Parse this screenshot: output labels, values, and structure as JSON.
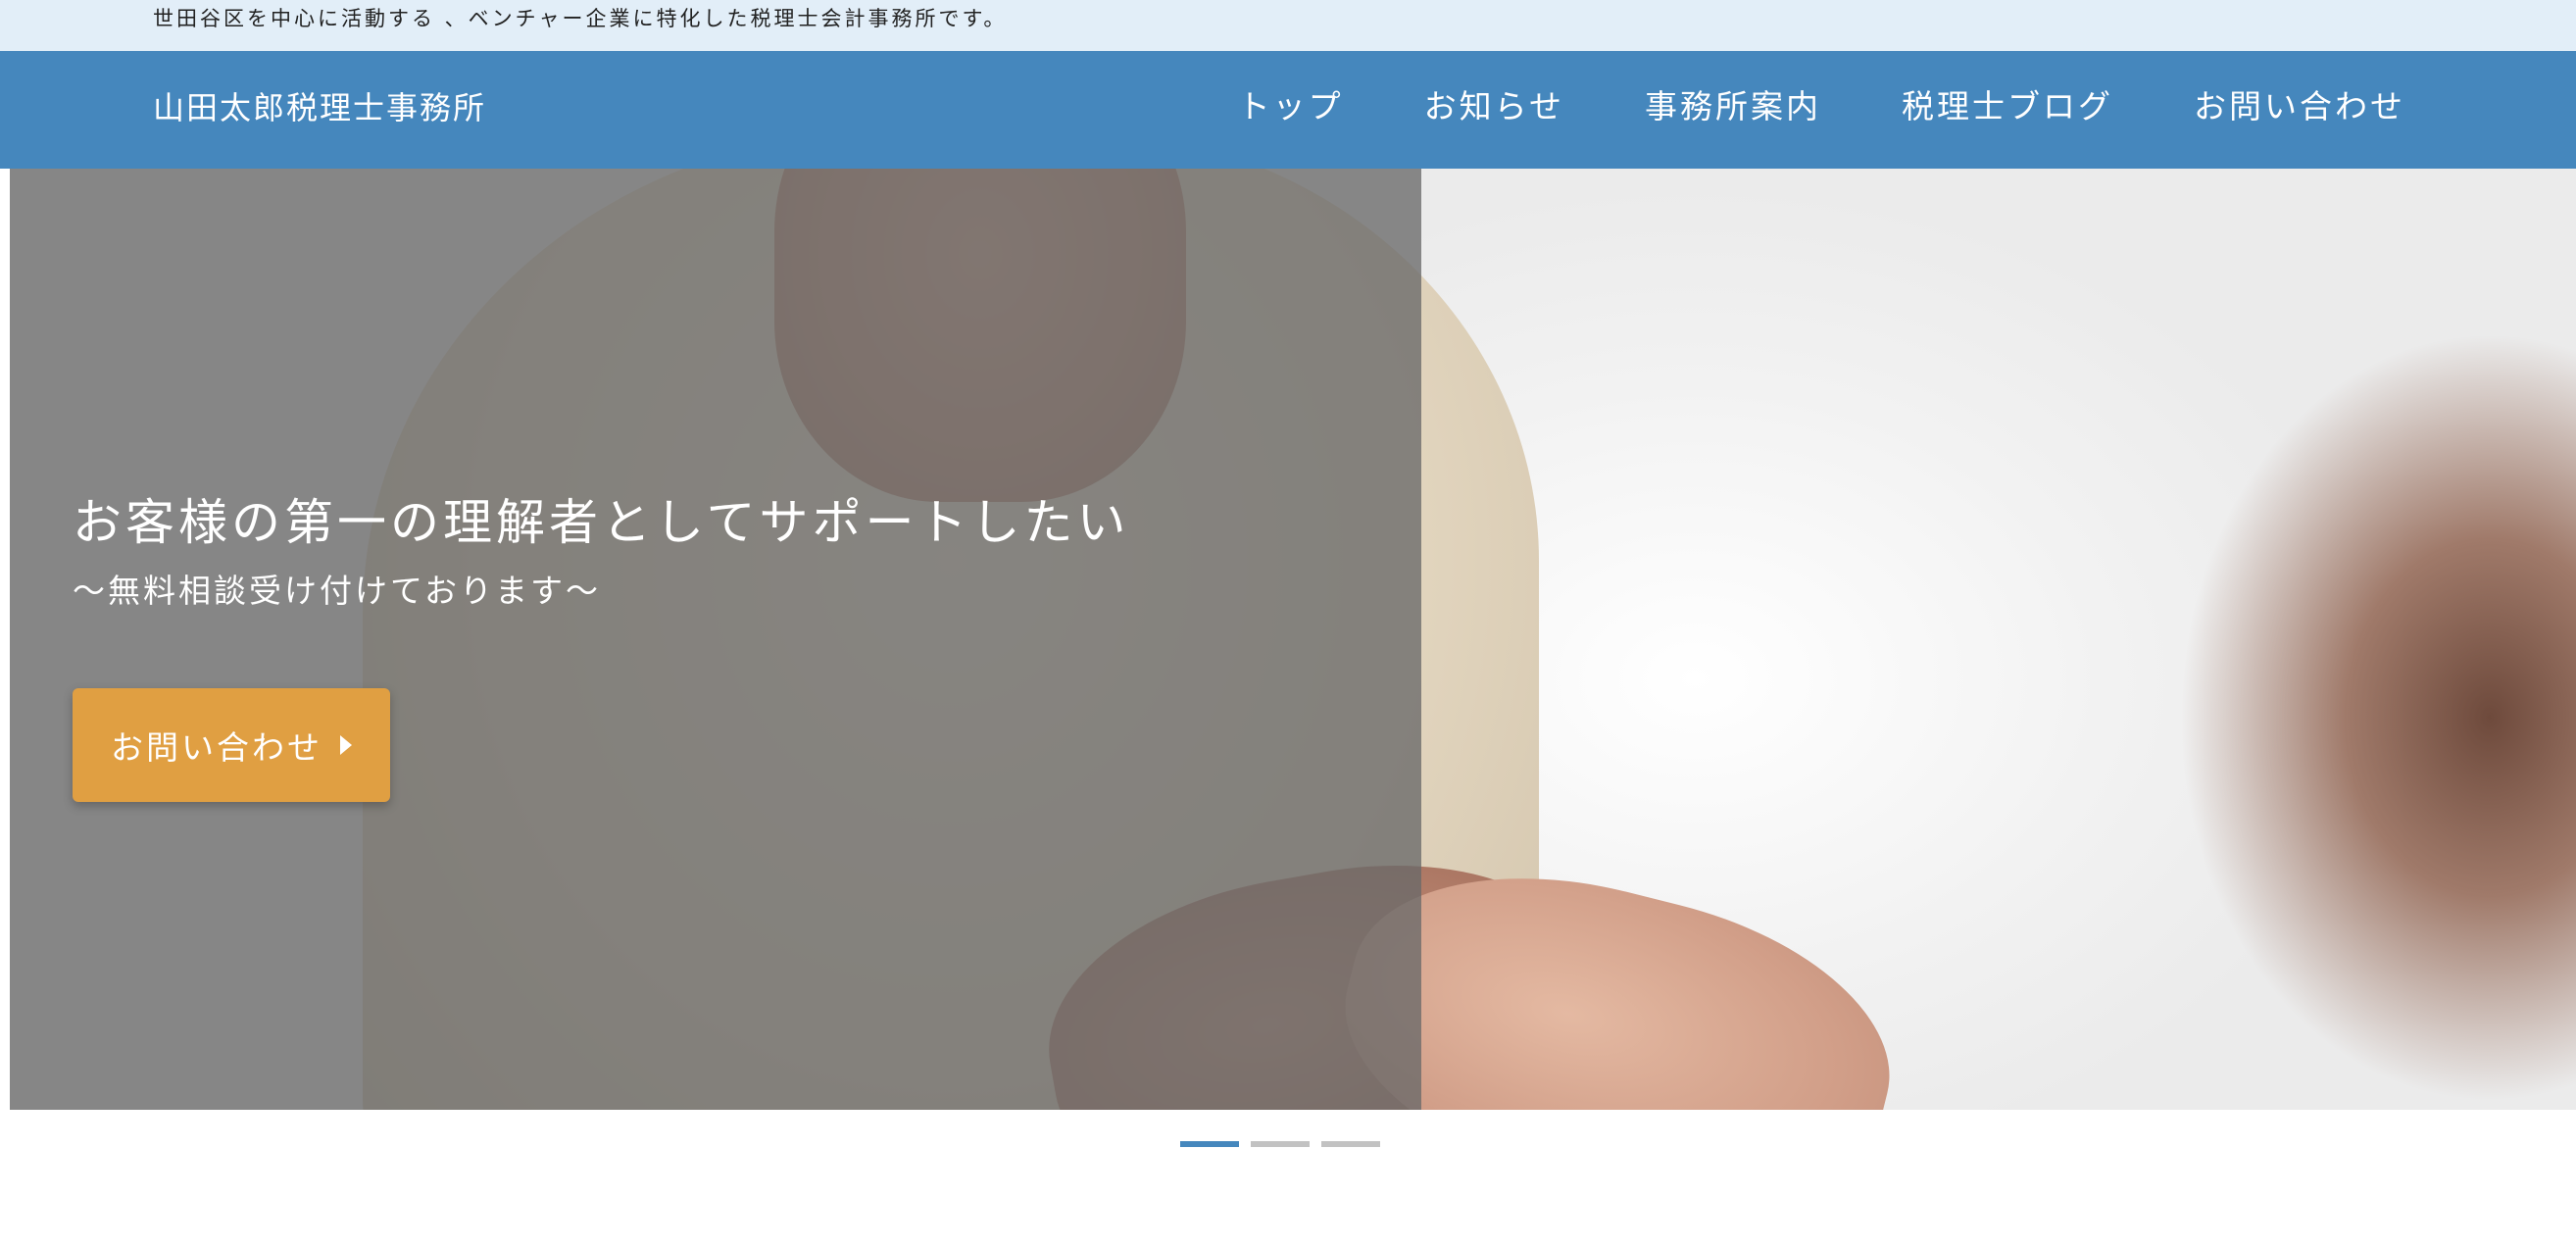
{
  "topbar": {
    "tagline": "世田谷区を中心に活動する 、ベンチャー企業に特化した税理士会計事務所です。"
  },
  "header": {
    "site_title": "山田太郎税理士事務所",
    "nav": [
      {
        "label": "トップ"
      },
      {
        "label": "お知らせ"
      },
      {
        "label": "事務所案内"
      },
      {
        "label": "税理士ブログ"
      },
      {
        "label": "お問い合わせ"
      }
    ]
  },
  "hero": {
    "title": "お客様の第一の理解者としてサポートしたい",
    "subtitle": "〜無料相談受け付けております〜",
    "cta_label": "お問い合わせ",
    "cta_icon": "caret-right-icon"
  },
  "slider": {
    "slides": 3,
    "active_index": 0
  },
  "colors": {
    "header_bg": "#4587bd",
    "topbar_bg": "#e2eef8",
    "cta_bg": "#e09f42",
    "indicator_active": "#4587bd",
    "indicator_inactive": "#c2c2c2"
  }
}
